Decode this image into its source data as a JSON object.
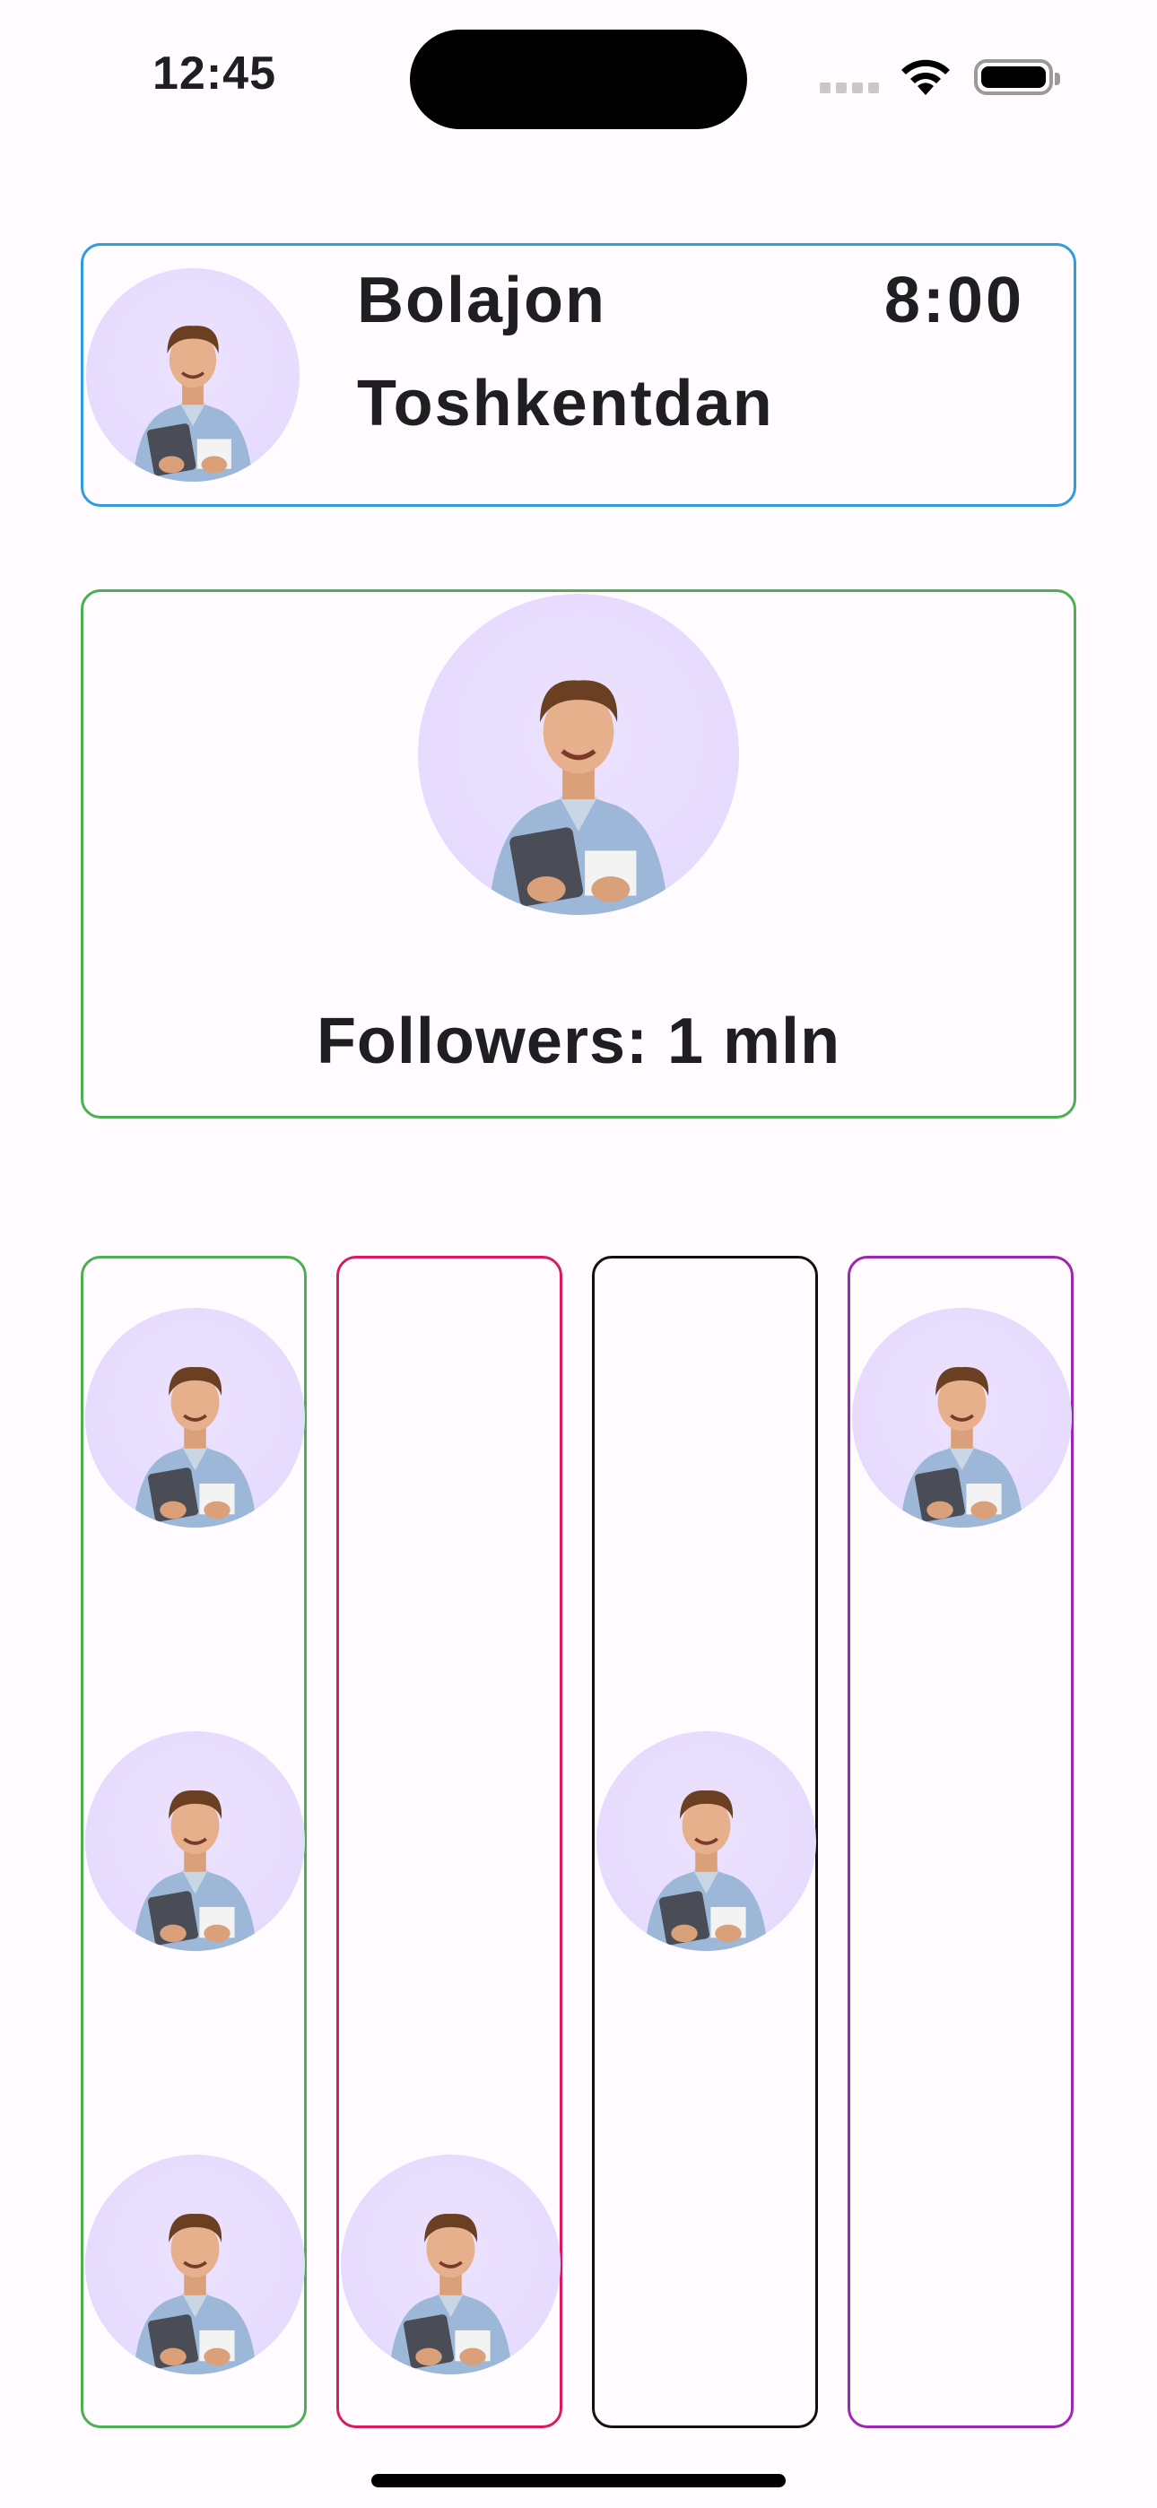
{
  "status_bar": {
    "time": "12:45",
    "signal_icon": "cellular-signal-icon",
    "wifi_icon": "wifi-icon",
    "battery_icon": "battery-icon",
    "battery_level": 1.0
  },
  "profile_card": {
    "name": "Bolajon",
    "city": "Toshkentdan",
    "time": "8:00",
    "border_color": "#2f9be0",
    "avatar_icon": "person-avatar-icon"
  },
  "followers_card": {
    "followers_text": "Followers: 1 mln",
    "border_color": "#4caf50",
    "avatar_icon": "person-avatar-icon"
  },
  "columns": [
    {
      "border_color": "#4caf50",
      "avatar_slots": [
        "top",
        "middle",
        "bottom"
      ]
    },
    {
      "border_color": "#d81b60",
      "avatar_slots": [
        "bottom"
      ]
    },
    {
      "border_color": "#111111",
      "avatar_slots": [
        "middle"
      ]
    },
    {
      "border_color": "#9c27b0",
      "avatar_slots": [
        "top"
      ]
    }
  ],
  "colors": {
    "background": "#fffbfe",
    "avatar_background": "#e6dbfd",
    "text": "#1f1f22"
  }
}
